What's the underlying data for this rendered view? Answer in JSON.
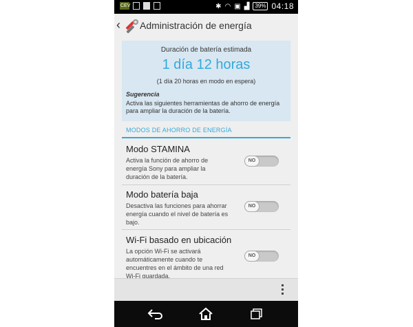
{
  "status_bar": {
    "notification_badge": "CEV",
    "battery": "39%",
    "time": "04:18"
  },
  "action_bar": {
    "title": "Administración de energía"
  },
  "summary": {
    "label": "Duración de batería estimada",
    "value": "1 día 12 horas",
    "standby": "(1 día 20 horas en modo en espera)",
    "tip_title": "Sugerencia",
    "tip_text": "Activa las siguientes herramientas de ahorro de energía para ampliar la duración de la batería."
  },
  "section": {
    "header": "MODOS DE AHORRO DE ENERGÍA"
  },
  "settings": [
    {
      "title": "Modo STAMINA",
      "desc": "Activa la función de ahorro de energía Sony para ampliar la duración de la batería.",
      "toggle": "NO"
    },
    {
      "title": "Modo batería baja",
      "desc": "Desactiva las funciones para ahorrar energía cuando el nivel de batería es bajo.",
      "toggle": "NO"
    },
    {
      "title": "Wi-Fi basado en ubicación",
      "desc": "La opción Wi-Fi se activará automáticamente cuando te encuentres en el ámbito de una red Wi-Fi guardada.",
      "toggle": "NO"
    }
  ],
  "icons": {
    "back": "back-arrow-icon",
    "home": "home-icon",
    "recents": "recent-apps-icon",
    "overflow": "overflow-menu-icon"
  },
  "colors": {
    "accent": "#33a9dc",
    "card_bg": "#d8e7f1",
    "screen_bg": "#efefef"
  }
}
